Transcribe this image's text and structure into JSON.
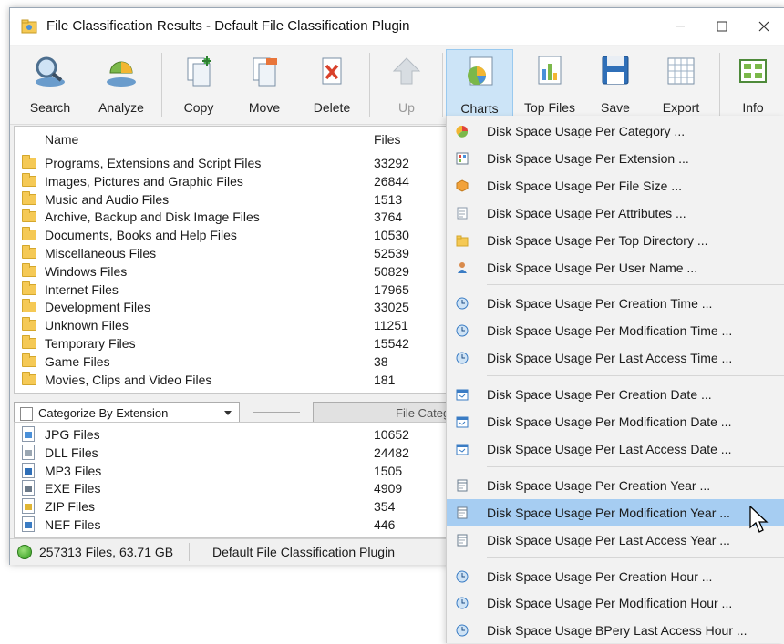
{
  "window": {
    "title": "File Classification Results - Default File Classification Plugin"
  },
  "toolbar": {
    "search": "Search",
    "analyze": "Analyze",
    "copy": "Copy",
    "move": "Move",
    "delete": "Delete",
    "up": "Up",
    "charts": "Charts",
    "top_files": "Top Files",
    "save": "Save",
    "export": "Export",
    "info": "Info"
  },
  "grid": {
    "col_name": "Name",
    "col_files": "Files",
    "rows": [
      {
        "name": "Programs, Extensions and Script Files",
        "files": "33292"
      },
      {
        "name": "Images, Pictures and Graphic Files",
        "files": "26844"
      },
      {
        "name": "Music and Audio Files",
        "files": "1513"
      },
      {
        "name": "Archive, Backup and Disk Image Files",
        "files": "3764"
      },
      {
        "name": "Documents, Books and Help Files",
        "files": "10530"
      },
      {
        "name": "Miscellaneous Files",
        "files": "52539"
      },
      {
        "name": "Windows Files",
        "files": "50829"
      },
      {
        "name": "Internet Files",
        "files": "17965"
      },
      {
        "name": "Development Files",
        "files": "33025"
      },
      {
        "name": "Unknown Files",
        "files": "11251"
      },
      {
        "name": "Temporary Files",
        "files": "15542"
      },
      {
        "name": "Game Files",
        "files": "38"
      },
      {
        "name": "Movies, Clips and Video Files",
        "files": "181"
      }
    ]
  },
  "midbar": {
    "categorize_value": "Categorize By Extension",
    "file_category_button": "File Categ"
  },
  "ext_grid": {
    "rows": [
      {
        "name": "JPG Files",
        "files": "10652",
        "icon": "jpg-icon"
      },
      {
        "name": "DLL Files",
        "files": "24482",
        "icon": "dll-icon"
      },
      {
        "name": "MP3 Files",
        "files": "1505",
        "icon": "mp3-icon"
      },
      {
        "name": "EXE Files",
        "files": "4909",
        "icon": "exe-icon"
      },
      {
        "name": "ZIP Files",
        "files": "354",
        "icon": "zip-icon"
      },
      {
        "name": "NEF Files",
        "files": "446",
        "icon": "nef-icon"
      }
    ]
  },
  "status": {
    "summary": "257313 Files, 63.71 GB",
    "plugin": "Default File Classification Plugin"
  },
  "charts_menu": {
    "groups": [
      [
        {
          "label": "Disk Space Usage Per Category ...",
          "icon": "category-icon"
        },
        {
          "label": "Disk Space Usage Per Extension ...",
          "icon": "extension-icon"
        },
        {
          "label": "Disk Space Usage Per File Size ...",
          "icon": "file-size-icon"
        },
        {
          "label": "Disk Space Usage Per Attributes ...",
          "icon": "attributes-icon"
        },
        {
          "label": "Disk Space Usage Per Top Directory ...",
          "icon": "folder-icon"
        },
        {
          "label": "Disk Space Usage Per User Name ...",
          "icon": "user-icon"
        }
      ],
      [
        {
          "label": "Disk Space Usage Per Creation Time ...",
          "icon": "clock-icon"
        },
        {
          "label": "Disk Space Usage Per Modification Time ...",
          "icon": "clock-icon"
        },
        {
          "label": "Disk Space Usage Per Last Access Time ...",
          "icon": "clock-icon"
        }
      ],
      [
        {
          "label": "Disk Space Usage Per Creation Date ...",
          "icon": "calendar-icon"
        },
        {
          "label": "Disk Space Usage Per Modification Date ...",
          "icon": "calendar-icon"
        },
        {
          "label": "Disk Space Usage Per Last Access Date ...",
          "icon": "calendar-icon"
        }
      ],
      [
        {
          "label": "Disk Space Usage Per Creation Year ...",
          "icon": "year-icon"
        },
        {
          "label": "Disk Space Usage Per Modification Year ...",
          "icon": "year-icon",
          "highlighted": true
        },
        {
          "label": "Disk Space Usage Per Last Access Year ...",
          "icon": "year-icon"
        }
      ],
      [
        {
          "label": "Disk Space Usage Per Creation Hour ...",
          "icon": "clock-icon"
        },
        {
          "label": "Disk Space Usage Per Modification Hour ...",
          "icon": "clock-icon"
        },
        {
          "label": "Disk Space Usage BPery Last Access Hour ...",
          "icon": "clock-icon"
        }
      ]
    ]
  },
  "colors": {
    "highlight": "#a6cdf2",
    "active_button": "#cce4f7",
    "folder": "#f5c955"
  }
}
